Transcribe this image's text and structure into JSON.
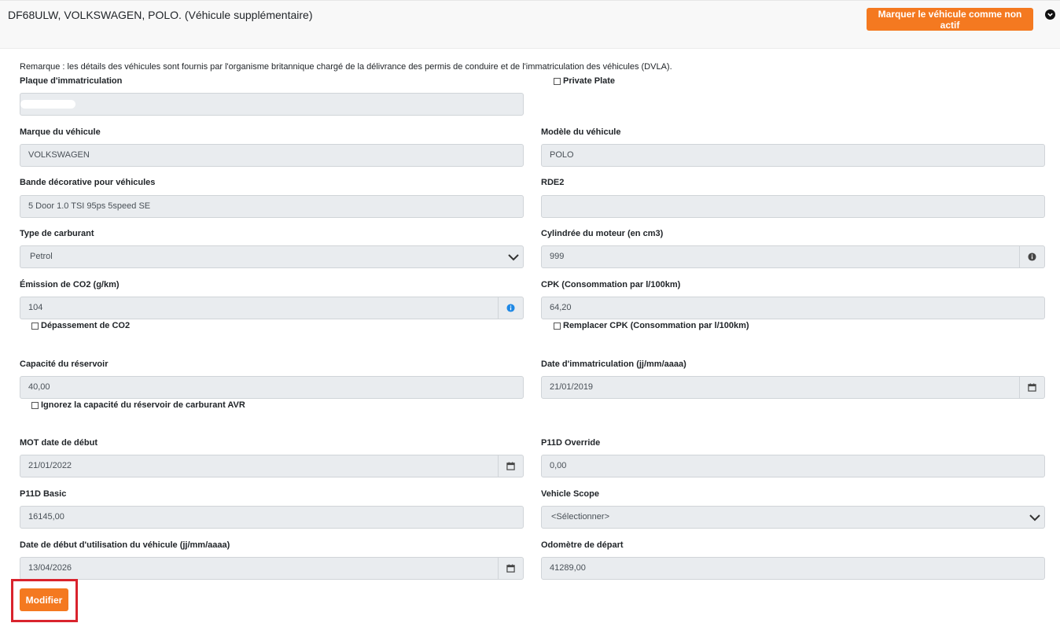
{
  "header": {
    "vehicle_title": "DF68ULW, VOLKSWAGEN, POLO. (Véhicule supplémentaire)",
    "mark_inactive_label": "Marquer le véhicule comme non actif"
  },
  "remark": "Remarque : les détails des véhicules sont fournis par l'organisme britannique chargé de la délivrance des permis de conduire et de l'immatriculation des véhicules (DVLA).",
  "form": {
    "plate_label": "Plaque d'immatriculation",
    "private_plate_label": "Private Plate",
    "make_label": "Marque du véhicule",
    "make_value": "VOLKSWAGEN",
    "model_label": "Modèle du véhicule",
    "model_value": "POLO",
    "trim_label": "Bande décorative pour véhicules",
    "trim_value": "5 Door 1.0 TSI 95ps 5speed SE",
    "rde2_label": "RDE2",
    "rde2_value": "",
    "fuel_label": "Type de carburant",
    "fuel_value": "Petrol",
    "engine_label": "Cylindrée du moteur (en cm3)",
    "engine_value": "999",
    "co2_label": "Émission de CO2 (g/km)",
    "co2_value": "104",
    "co2_over_label": "Dépassement de CO2",
    "cpk_label": "CPK (Consommation par l/100km)",
    "cpk_value": "64,20",
    "cpk_replace_label": "Remplacer CPK (Consommation par l/100km)",
    "tank_label": "Capacité du réservoir",
    "tank_value": "40,00",
    "tank_ignore_label": "Ignorez la capacité du réservoir de carburant AVR",
    "reg_date_label": "Date d'immatriculation (jj/mm/aaaa)",
    "reg_date_value": "21/01/2019",
    "mot_label": "MOT date de début",
    "mot_value": "21/01/2022",
    "p11d_override_label": "P11D Override",
    "p11d_override_value": "0,00",
    "p11d_basic_label": "P11D Basic",
    "p11d_basic_value": "16145,00",
    "scope_label": "Vehicle Scope",
    "scope_value": "<Sélectionner>",
    "use_start_label": "Date de début d'utilisation du véhicule (jj/mm/aaaa)",
    "use_start_value": "13/04/2026",
    "odometer_label": "Odomètre de départ",
    "odometer_value": "41289,00"
  },
  "actions": {
    "modify_label": "Modifier"
  },
  "colors": {
    "accent": "#f47920",
    "highlight": "#d9232d",
    "info": "#1e88e5"
  }
}
